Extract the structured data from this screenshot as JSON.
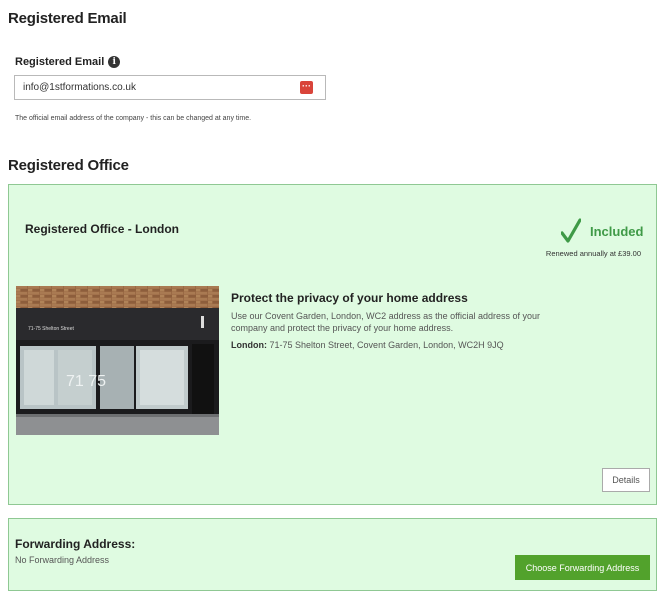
{
  "registered_email": {
    "section_heading": "Registered Email",
    "field_label": "Registered Email",
    "value": "info@1stformations.co.uk",
    "helper_text": "The official email address of the company - this can be changed at any time.",
    "icons": {
      "info": "info-icon",
      "password_manager": "password-manager-icon"
    }
  },
  "registered_office": {
    "section_heading": "Registered Office",
    "panel_title": "Registered Office - London",
    "status_label": "Included",
    "renewal_text": "Renewed annually at £39.00",
    "photo_sign_text": "71-75 Shelton Street",
    "photo_number": "71  75",
    "promo_title": "Protect the privacy of your home address",
    "promo_text": "Use our Covent Garden, London, WC2 address as the official address of your company and protect the privacy of your home address.",
    "address_label": "London:",
    "address_value": "71-75 Shelton Street, Covent Garden, London, WC2H 9JQ",
    "details_button": "Details",
    "colors": {
      "panel_bg": "#dffbe1",
      "panel_border": "#8fc893",
      "included_green": "#3f9a47"
    }
  },
  "forwarding": {
    "title": "Forwarding Address:",
    "subtitle": "No Forwarding Address",
    "button_label": "Choose Forwarding Address",
    "button_color": "#52a22c"
  }
}
